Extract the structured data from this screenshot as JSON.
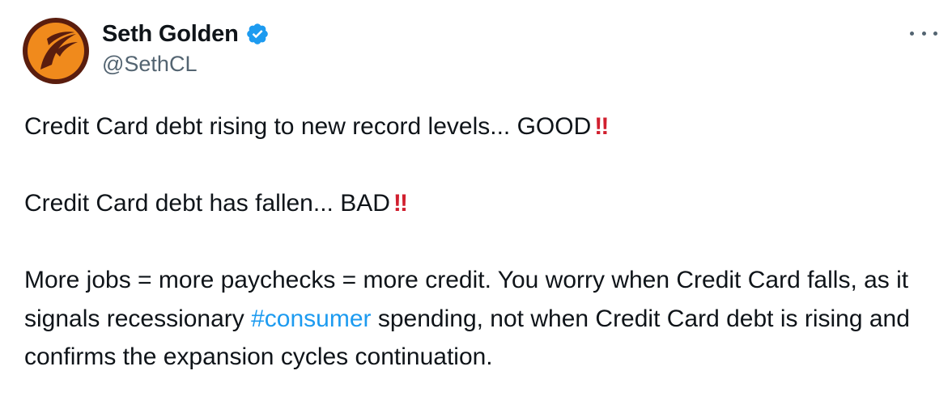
{
  "author": {
    "display_name": "Seth Golden",
    "handle": "@SethCL",
    "verified": true,
    "avatar_icon": "orange-swoosh-logo-icon"
  },
  "menu_icon": "more-horizontal-icon",
  "tweet": {
    "line1_text": "Credit Card debt rising to new record levels... GOOD",
    "line1_emoji": "‼",
    "line2_text": "Credit Card debt has fallen... BAD",
    "line2_emoji": "‼",
    "line3_before": "More jobs = more paychecks = more credit. You worry when Credit Card falls, as it signals recessionary ",
    "hashtag": "#consumer",
    "line3_after": " spending, not when Credit Card debt is rising and confirms the expansion cycles continuation."
  },
  "colors": {
    "link": "#1d9bf0",
    "verified_badge": "#1d9bf0",
    "secondary_text": "#536471",
    "emoji_red": "#d11f2e",
    "avatar_bg": "#5a1d0e",
    "avatar_logo": "#f08a1c"
  }
}
